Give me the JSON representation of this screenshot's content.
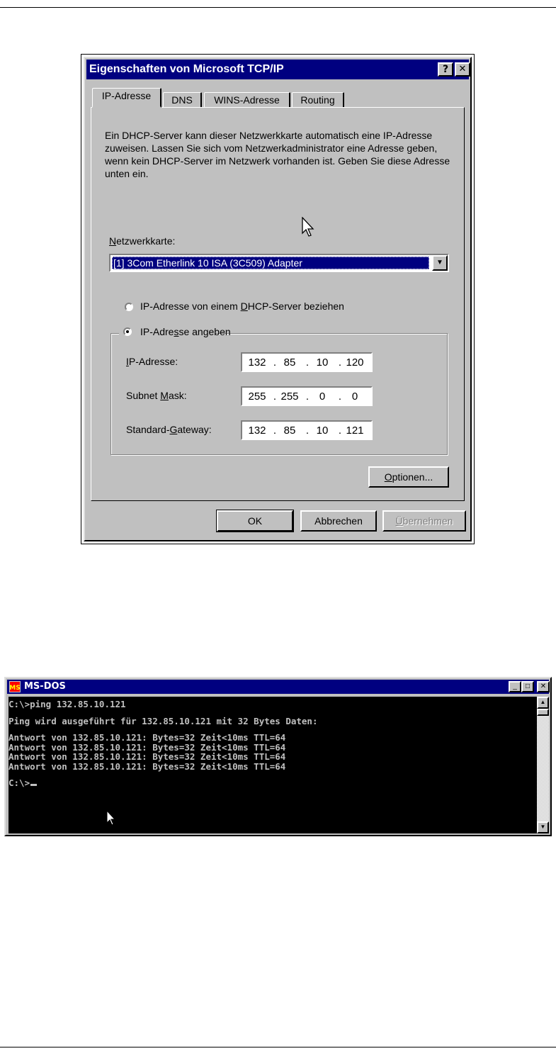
{
  "dialog": {
    "title": "Eigenschaften von Microsoft TCP/IP",
    "help_button": "?",
    "close_button": "✕",
    "tabs": [
      {
        "label": "IP-Adresse",
        "active": true
      },
      {
        "label": "DNS",
        "active": false
      },
      {
        "label": "WINS-Adresse",
        "active": false
      },
      {
        "label": "Routing",
        "active": false
      }
    ],
    "description": "Ein DHCP-Server kann dieser Netzwerkkarte automatisch eine IP-Adresse zuweisen. Lassen Sie sich vom Netzwerkadministrator eine Adresse geben, wenn kein DHCP-Server im Netzwerk vorhanden ist. Geben Sie diese Adresse unten ein.",
    "adapter_label_accel": "N",
    "adapter_label_rest": "etzwerkkarte:",
    "adapter_selected": "[1] 3Com Etherlink 10 ISA (3C509) Adapter",
    "radio_dhcp": {
      "before": "IP-Adresse von einem ",
      "accel": "D",
      "after": "HCP-Server beziehen",
      "selected": false
    },
    "radio_manual": {
      "before": "IP-Adre",
      "accel": "s",
      "after": "se angeben",
      "selected": true
    },
    "fields": {
      "ip": {
        "accel": "I",
        "rest": "P-Adresse:",
        "octets": [
          "132",
          "85",
          "10",
          "120"
        ]
      },
      "mask": {
        "before": "Subnet ",
        "accel": "M",
        "after": "ask:",
        "octets": [
          "255",
          "255",
          "0",
          "0"
        ]
      },
      "gateway": {
        "before": "Standard-",
        "accel": "G",
        "after": "ateway:",
        "octets": [
          "132",
          "85",
          "10",
          "121"
        ]
      }
    },
    "dot": ".",
    "options_button": {
      "accel": "O",
      "rest": "ptionen..."
    },
    "buttons": {
      "ok": "OK",
      "cancel": "Abbrechen",
      "apply_accel": "Ü",
      "apply_rest": "bernehmen"
    }
  },
  "dos": {
    "title": "MS-DOS",
    "icon_label": "MS",
    "controls": {
      "minimize": "_",
      "maximize": "□",
      "close": "✕"
    },
    "lines": [
      "C:\\>ping 132.85.10.121",
      "Ping wird ausgeführt für 132.85.10.121 mit 32 Bytes Daten:",
      "Antwort von 132.85.10.121: Bytes=32 Zeit<10ms TTL=64",
      "Antwort von 132.85.10.121: Bytes=32 Zeit<10ms TTL=64",
      "Antwort von 132.85.10.121: Bytes=32 Zeit<10ms TTL=64",
      "Antwort von 132.85.10.121: Bytes=32 Zeit<10ms TTL=64"
    ],
    "prompt": "C:\\>",
    "scroll_up": "▲",
    "scroll_down": "▼"
  }
}
